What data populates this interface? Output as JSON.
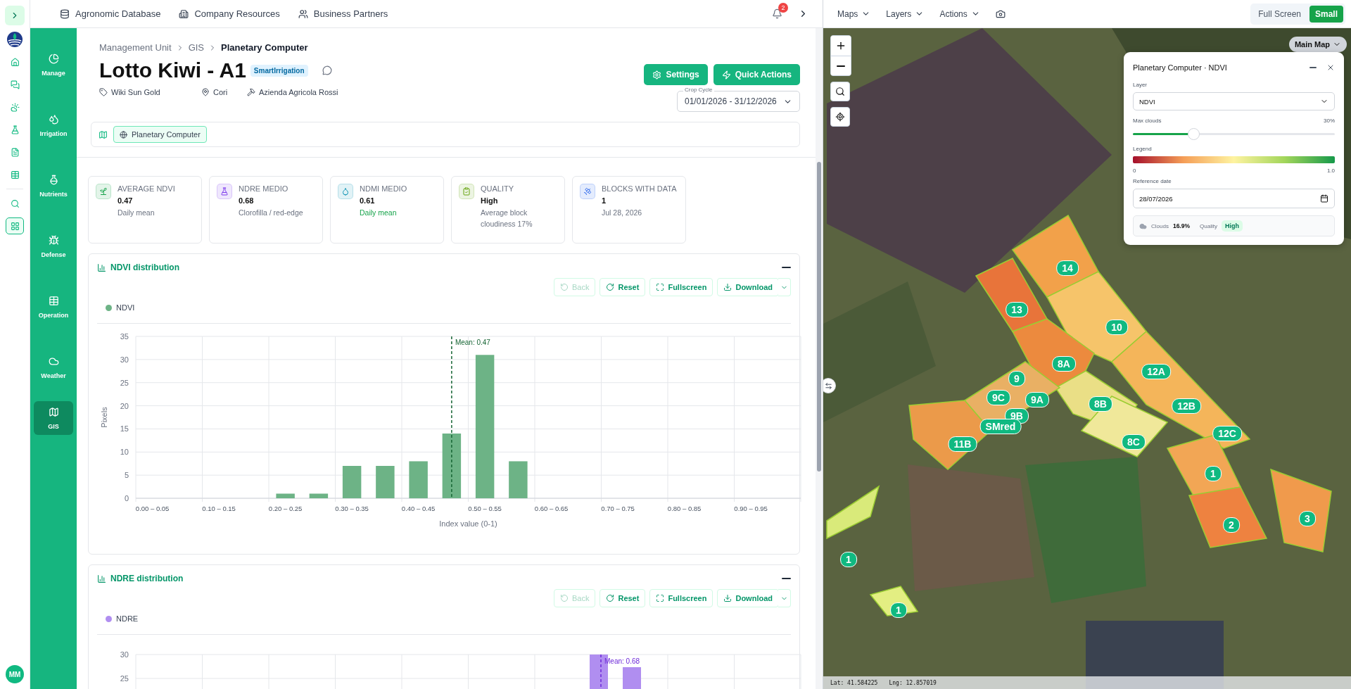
{
  "top_nav": {
    "items": [
      {
        "label": "Agronomic Database"
      },
      {
        "label": "Company Resources"
      },
      {
        "label": "Business Partners"
      }
    ],
    "notifications": "2"
  },
  "rail": {
    "items": [
      {
        "selected": false
      },
      {
        "selected": false
      },
      {
        "selected": false
      },
      {
        "selected": false
      },
      {
        "selected": false
      },
      {
        "selected": false
      },
      {
        "selected": false
      },
      {
        "selected": true
      }
    ],
    "avatar": "MM"
  },
  "sidebar": {
    "items": [
      {
        "label": "Manage",
        "selected": false
      },
      {
        "label": "Irrigation",
        "selected": false
      },
      {
        "label": "Nutrients",
        "selected": false
      },
      {
        "label": "Defense",
        "selected": false
      },
      {
        "label": "Operation",
        "selected": false
      },
      {
        "label": "Weather",
        "selected": false
      },
      {
        "label": "GIS",
        "selected": true
      }
    ]
  },
  "breadcrumb": [
    "Management Unit",
    "GIS",
    "Planetary Computer"
  ],
  "header": {
    "title": "Lotto Kiwi - A1",
    "badge": "SmartIrrigation",
    "meta": [
      "Wiki Sun Gold",
      "Cori",
      "Azienda Agricola Rossi"
    ],
    "buttons": [
      "Settings",
      "Quick Actions"
    ],
    "crop_cycle": {
      "label": "Crop Cycle",
      "value": "01/01/2026 - 31/12/2026"
    }
  },
  "source_tabs": [
    {
      "label": "Planetary Computer",
      "selected": true
    }
  ],
  "stats": [
    {
      "label": "AVERAGE NDVI",
      "value": "0.47",
      "note": "Daily mean",
      "note_highlight": false
    },
    {
      "label": "NDRE MEDIO",
      "value": "0.68",
      "note": "Clorofilla / red-edge",
      "note_highlight": false
    },
    {
      "label": "NDMI MEDIO",
      "value": "0.61",
      "note": "Daily mean",
      "note_highlight": true
    },
    {
      "label": "QUALITY",
      "value": "High",
      "note": "Average block cloudiness 17%",
      "note_highlight": false
    },
    {
      "label": "BLOCKS WITH DATA",
      "value": "1",
      "note": "Jul 28, 2026",
      "note_highlight": false
    }
  ],
  "ndvi_panel": {
    "title": "NDVI distribution",
    "toolbar": [
      {
        "label": "Back",
        "disabled": true
      },
      {
        "label": "Reset",
        "disabled": false
      },
      {
        "label": "Fullscreen",
        "disabled": false
      },
      {
        "label": "Download",
        "disabled": false
      }
    ],
    "chart_data": {
      "type": "bar",
      "xlabel": "Index value (0-1)",
      "ylabel": "Pixels",
      "categories": [
        "0.00 – 0.05",
        null,
        "0.10 – 0.15",
        null,
        "0.20 – 0.25",
        null,
        "0.30 – 0.35",
        null,
        "0.40 – 0.45",
        null,
        "0.50 – 0.55",
        null,
        "0.60 – 0.65",
        null,
        "0.70 – 0.75",
        null,
        "0.80 – 0.85",
        null,
        "0.90 – 0.95",
        null
      ],
      "series": [
        {
          "name": "NDVI",
          "color": "#6db386",
          "values": [
            0,
            0,
            0,
            0,
            1,
            1,
            7,
            7,
            8,
            14,
            31,
            8,
            0,
            0,
            0,
            0,
            0,
            0,
            0,
            0
          ]
        }
      ],
      "ylim": [
        0,
        35
      ],
      "yticks": [
        0,
        5,
        10,
        15,
        20,
        25,
        30,
        35
      ],
      "grid": true,
      "annotations": [
        "Mean: 0.47"
      ]
    }
  },
  "ndre_panel": {
    "title": "NDRE distribution",
    "toolbar": [
      {
        "label": "Back",
        "disabled": true
      },
      {
        "label": "Reset",
        "disabled": false
      },
      {
        "label": "Fullscreen",
        "disabled": false
      },
      {
        "label": "Download",
        "disabled": false
      }
    ],
    "legend": "NDRE",
    "y_labels": [
      "30",
      "25"
    ],
    "mean_label": "Mean: 0.68"
  },
  "map_toolbar": {
    "menus": [
      "Maps",
      "Layers",
      "Actions"
    ],
    "views": [
      {
        "label": "Full Screen",
        "selected": false
      },
      {
        "label": "Small",
        "selected": true
      }
    ]
  },
  "map": {
    "base_layer": "Main Map",
    "plots": [
      {
        "label": "14"
      },
      {
        "label": "13"
      },
      {
        "label": "10"
      },
      {
        "label": "8A"
      },
      {
        "label": "9"
      },
      {
        "label": "12A"
      },
      {
        "label": "9C"
      },
      {
        "label": "9A"
      },
      {
        "label": "8B"
      },
      {
        "label": "12B"
      },
      {
        "label": "9B"
      },
      {
        "label": "SMred"
      },
      {
        "label": "12C"
      },
      {
        "label": "11B"
      },
      {
        "label": "8C"
      },
      {
        "label": "1"
      },
      {
        "label": "2"
      },
      {
        "label": "3"
      },
      {
        "label": "1"
      },
      {
        "label": "1"
      }
    ],
    "lat": "Lat: 41.584225",
    "lng": "Lng: 12.857019"
  },
  "layer_panel": {
    "title": "Planetary Computer · NDVI",
    "layer_label": "Layer",
    "layer_value": "NDVI",
    "max_clouds": {
      "label": "Max clouds",
      "reading": "30%",
      "level": 0.3
    },
    "legend_label": "Legend",
    "legend_min": "0",
    "legend_max": "1.0",
    "date_label": "Reference date",
    "date_value": "28/07/2026",
    "clouds_name": "Clouds",
    "clouds_value": "16.9%",
    "quality_name": "Quality",
    "quality_value": "High"
  }
}
